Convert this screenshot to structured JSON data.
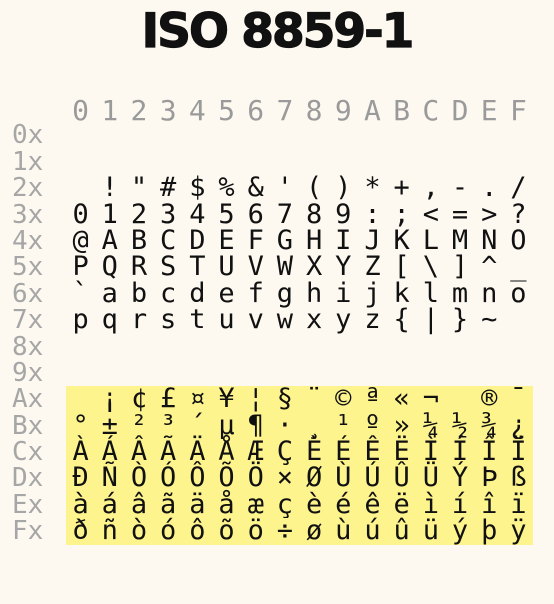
{
  "title": "ISO 8859-1",
  "column_headers": [
    "0",
    "1",
    "2",
    "3",
    "4",
    "5",
    "6",
    "7",
    "8",
    "9",
    "A",
    "B",
    "C",
    "D",
    "E",
    "F"
  ],
  "highlight_color": "#fdf48e",
  "highlight_rows": [
    "Ax",
    "Bx",
    "Cx",
    "Dx",
    "Ex",
    "Fx"
  ],
  "rows": [
    {
      "label": "0x",
      "cells": [
        "",
        "",
        "",
        "",
        "",
        "",
        "",
        "",
        "",
        "",
        "",
        "",
        "",
        "",
        "",
        ""
      ]
    },
    {
      "label": "1x",
      "cells": [
        "",
        "",
        "",
        "",
        "",
        "",
        "",
        "",
        "",
        "",
        "",
        "",
        "",
        "",
        "",
        ""
      ]
    },
    {
      "label": "2x",
      "cells": [
        " ",
        "!",
        "\"",
        "#",
        "$",
        "%",
        "&",
        "'",
        "(",
        ")",
        "*",
        "+",
        ",",
        "-",
        ".",
        "/"
      ]
    },
    {
      "label": "3x",
      "cells": [
        "0",
        "1",
        "2",
        "3",
        "4",
        "5",
        "6",
        "7",
        "8",
        "9",
        ":",
        ";",
        "<",
        "=",
        ">",
        "?"
      ]
    },
    {
      "label": "4x",
      "cells": [
        "@",
        "A",
        "B",
        "C",
        "D",
        "E",
        "F",
        "G",
        "H",
        "I",
        "J",
        "K",
        "L",
        "M",
        "N",
        "O"
      ]
    },
    {
      "label": "5x",
      "cells": [
        "P",
        "Q",
        "R",
        "S",
        "T",
        "U",
        "V",
        "W",
        "X",
        "Y",
        "Z",
        "[",
        "\\",
        "]",
        "^",
        "_"
      ]
    },
    {
      "label": "6x",
      "cells": [
        "`",
        "a",
        "b",
        "c",
        "d",
        "e",
        "f",
        "g",
        "h",
        "i",
        "j",
        "k",
        "l",
        "m",
        "n",
        "o"
      ]
    },
    {
      "label": "7x",
      "cells": [
        "p",
        "q",
        "r",
        "s",
        "t",
        "u",
        "v",
        "w",
        "x",
        "y",
        "z",
        "{",
        "|",
        "}",
        "~",
        ""
      ]
    },
    {
      "label": "8x",
      "cells": [
        "",
        "",
        "",
        "",
        "",
        "",
        "",
        "",
        "",
        "",
        "",
        "",
        "",
        "",
        "",
        ""
      ]
    },
    {
      "label": "9x",
      "cells": [
        "",
        "",
        "",
        "",
        "",
        "",
        "",
        "",
        "",
        "",
        "",
        "",
        "",
        "",
        "",
        ""
      ]
    },
    {
      "label": "Ax",
      "cells": [
        " ",
        "¡",
        "¢",
        "£",
        "¤",
        "¥",
        "¦",
        "§",
        "¨",
        "©",
        "ª",
        "«",
        "¬",
        "",
        "®",
        "¯"
      ]
    },
    {
      "label": "Bx",
      "cells": [
        "°",
        "±",
        "²",
        "³",
        "´",
        "µ",
        "¶",
        "·",
        "¸",
        "¹",
        "º",
        "»",
        "¼",
        "½",
        "¾",
        "¿"
      ]
    },
    {
      "label": "Cx",
      "cells": [
        "À",
        "Á",
        "Â",
        "Ã",
        "Ä",
        "Å",
        "Æ",
        "Ç",
        "È",
        "É",
        "Ê",
        "Ë",
        "Ì",
        "Í",
        "Î",
        "Ï"
      ]
    },
    {
      "label": "Dx",
      "cells": [
        "Ð",
        "Ñ",
        "Ò",
        "Ó",
        "Ô",
        "Õ",
        "Ö",
        "×",
        "Ø",
        "Ù",
        "Ú",
        "Û",
        "Ü",
        "Ý",
        "Þ",
        "ß"
      ]
    },
    {
      "label": "Ex",
      "cells": [
        "à",
        "á",
        "â",
        "ã",
        "ä",
        "å",
        "æ",
        "ç",
        "è",
        "é",
        "ê",
        "ë",
        "ì",
        "í",
        "î",
        "ï"
      ]
    },
    {
      "label": "Fx",
      "cells": [
        "ð",
        "ñ",
        "ò",
        "ó",
        "ô",
        "õ",
        "ö",
        "÷",
        "ø",
        "ù",
        "ú",
        "û",
        "ü",
        "ý",
        "þ",
        "ÿ"
      ]
    }
  ]
}
